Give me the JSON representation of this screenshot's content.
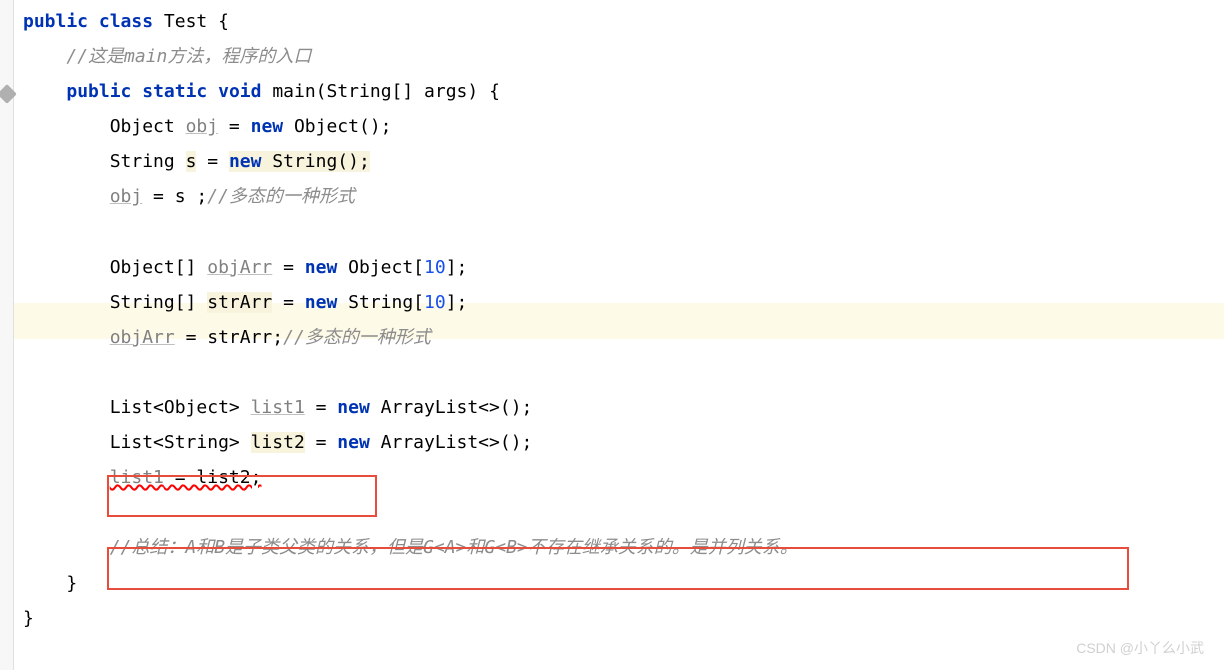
{
  "code": {
    "line1": {
      "kw1": "public",
      "kw2": "class",
      "name": "Test",
      "brace": " {"
    },
    "line2": {
      "comment": "//这是main方法，程序的入口"
    },
    "line3": {
      "kw1": "public",
      "kw2": "static",
      "kw3": "void",
      "name": "main",
      "params": "(String[] args) {"
    },
    "line4": {
      "type": "Object",
      "var": "obj",
      "eq": " = ",
      "kw": "new",
      "ctor": " Object();"
    },
    "line5": {
      "type": "String",
      "var": "s",
      "eq": " = ",
      "kw": "new",
      "ctor": " String();"
    },
    "line6": {
      "var": "obj",
      "rest": " = s ;",
      "comment": "//多态的一种形式"
    },
    "line7": {
      "type": "Object[]",
      "var": "objArr",
      "eq": " = ",
      "kw": "new",
      "ctor": " Object[",
      "num": "10",
      "end": "];"
    },
    "line8": {
      "type": "String[]",
      "var": "strArr",
      "eq": " = ",
      "kw": "new",
      "ctor": " String[",
      "num": "10",
      "end": "];"
    },
    "line9": {
      "var": "objArr",
      "rest": " = strArr;",
      "comment": "//多态的一种形式"
    },
    "line10": {
      "type1": "List<Object>",
      "var": "list1",
      "eq": " = ",
      "kw": "new",
      "ctor": " ArrayList<>();"
    },
    "line11": {
      "type1": "List<String>",
      "var": "list2",
      "eq": " = ",
      "kw": "new",
      "ctor": " ArrayList<>();"
    },
    "line12": {
      "var1": "list1",
      "rest": " = list2;"
    },
    "line13": {
      "comment": "//总结：A和B是子类父类的关系，但是G<A>和G<B>不存在继承关系的。是并列关系。"
    },
    "close1": "}",
    "close2": "}"
  },
  "watermark": "CSDN @小丫么小武"
}
